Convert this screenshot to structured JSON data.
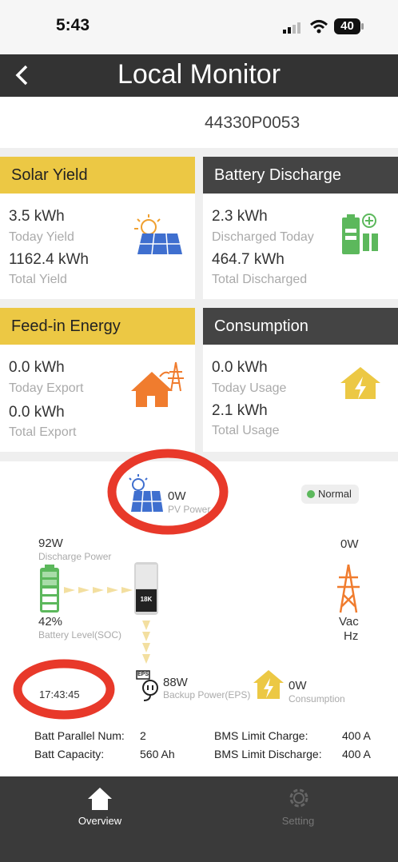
{
  "status_bar": {
    "time": "5:43",
    "battery": "40"
  },
  "header": {
    "title": "Local Monitor"
  },
  "device": {
    "serial": "44330P0053"
  },
  "cards": {
    "solar": {
      "title": "Solar Yield",
      "v1": "3.5 kWh",
      "l1": "Today Yield",
      "v2": "1162.4 kWh",
      "l2": "Total Yield"
    },
    "battery": {
      "title": "Battery Discharge",
      "v1": "2.3 kWh",
      "l1": "Discharged Today",
      "v2": "464.7 kWh",
      "l2": "Total Discharged"
    },
    "feedin": {
      "title": "Feed-in Energy",
      "v1": "0.0 kWh",
      "l1": "Today Export",
      "v2": "0.0 kWh",
      "l2": "Total Export"
    },
    "consumption": {
      "title": "Consumption",
      "v1": "0.0 kWh",
      "l1": "Today Usage",
      "v2": "2.1 kWh",
      "l2": "Total Usage"
    }
  },
  "flow": {
    "pv_value": "0W",
    "pv_label": "PV Power",
    "status": "Normal",
    "discharge_value": "92W",
    "discharge_label": "Discharge Power",
    "grid_value": "0W",
    "soc_value": "42%",
    "soc_label": "Battery Level(SOC)",
    "vac": "Vac",
    "hz": "Hz",
    "timestamp": "17:43:45",
    "eps_tag": "EPS",
    "inverter_text": "18K",
    "backup_value": "88W",
    "backup_label": "Backup Power(EPS)",
    "cons_value": "0W",
    "cons_label": "Consumption"
  },
  "details": {
    "parallel_label": "Batt Parallel Num:",
    "parallel_value": "2",
    "capacity_label": "Batt Capacity:",
    "capacity_value": "560 Ah",
    "bms_charge_label": "BMS Limit Charge:",
    "bms_charge_value": "400 A",
    "bms_discharge_label": "BMS Limit Discharge:",
    "bms_discharge_value": "400 A"
  },
  "bottom_nav": {
    "overview": "Overview",
    "setting": "Setting"
  },
  "colors": {
    "yellow": "#ecc844",
    "dark": "#444444",
    "green": "#5cb85c",
    "orange": "#f07c2e",
    "blue": "#3f6fcf",
    "annotation_red": "#e8392a"
  }
}
